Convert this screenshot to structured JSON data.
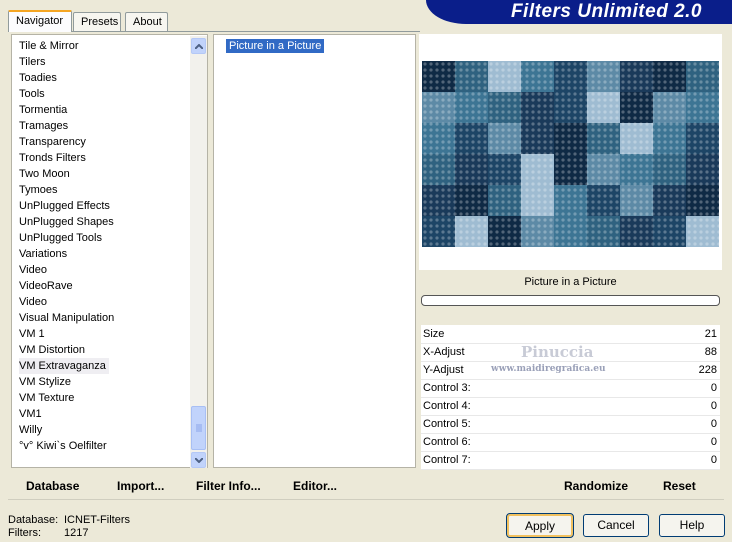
{
  "tabs": [
    {
      "label": "Navigator",
      "active": true
    },
    {
      "label": "Presets",
      "active": false
    },
    {
      "label": "About",
      "active": false
    }
  ],
  "app_title": "Filters Unlimited 2.0",
  "categories": [
    "Tile & Mirror",
    "Tilers",
    "Toadies",
    "Tools",
    "Tormentia",
    "Tramages",
    "Transparency",
    "Tronds Filters",
    "Two Moon",
    "Tymoes",
    "UnPlugged Effects",
    "UnPlugged Shapes",
    "UnPlugged Tools",
    "Variations",
    "Video",
    "VideoRave",
    "Video",
    "Visual Manipulation",
    "VM 1",
    "VM Distortion",
    "VM Extravaganza",
    "VM Stylize",
    "VM Texture",
    "VM1",
    "Willy",
    "°v° Kiwi`s Oelfilter"
  ],
  "selected_category": "VM Extravaganza",
  "filters": [
    "Picture in a Picture"
  ],
  "selected_filter": "Picture in a Picture",
  "preview": {
    "filter_name": "Picture in a Picture",
    "progress": 0
  },
  "controls": [
    {
      "label": "Size",
      "value": "21"
    },
    {
      "label": "X-Adjust",
      "value": "88"
    },
    {
      "label": "Y-Adjust",
      "value": "228"
    },
    {
      "label": "Control 3:",
      "value": "0"
    },
    {
      "label": "Control 4:",
      "value": "0"
    },
    {
      "label": "Control 5:",
      "value": "0"
    },
    {
      "label": "Control 6:",
      "value": "0"
    },
    {
      "label": "Control 7:",
      "value": "0"
    }
  ],
  "watermark": {
    "name": "Pinuccia",
    "site": "www.maidiregrafica.eu"
  },
  "toolbar": {
    "database": "Database",
    "import": "Import...",
    "filter_info": "Filter Info...",
    "editor": "Editor...",
    "randomize": "Randomize",
    "reset": "Reset"
  },
  "status": {
    "database_label": "Database:",
    "database_value": "ICNET-Filters",
    "filters_label": "Filters:",
    "filters_value": "1217"
  },
  "buttons": {
    "apply": "Apply",
    "cancel": "Cancel",
    "help": "Help"
  },
  "colors": {
    "banner": "#0a1e8a",
    "selection": "#316ac5",
    "preview_dark": "#0f2a45",
    "preview_light": "#c8d6e6"
  }
}
